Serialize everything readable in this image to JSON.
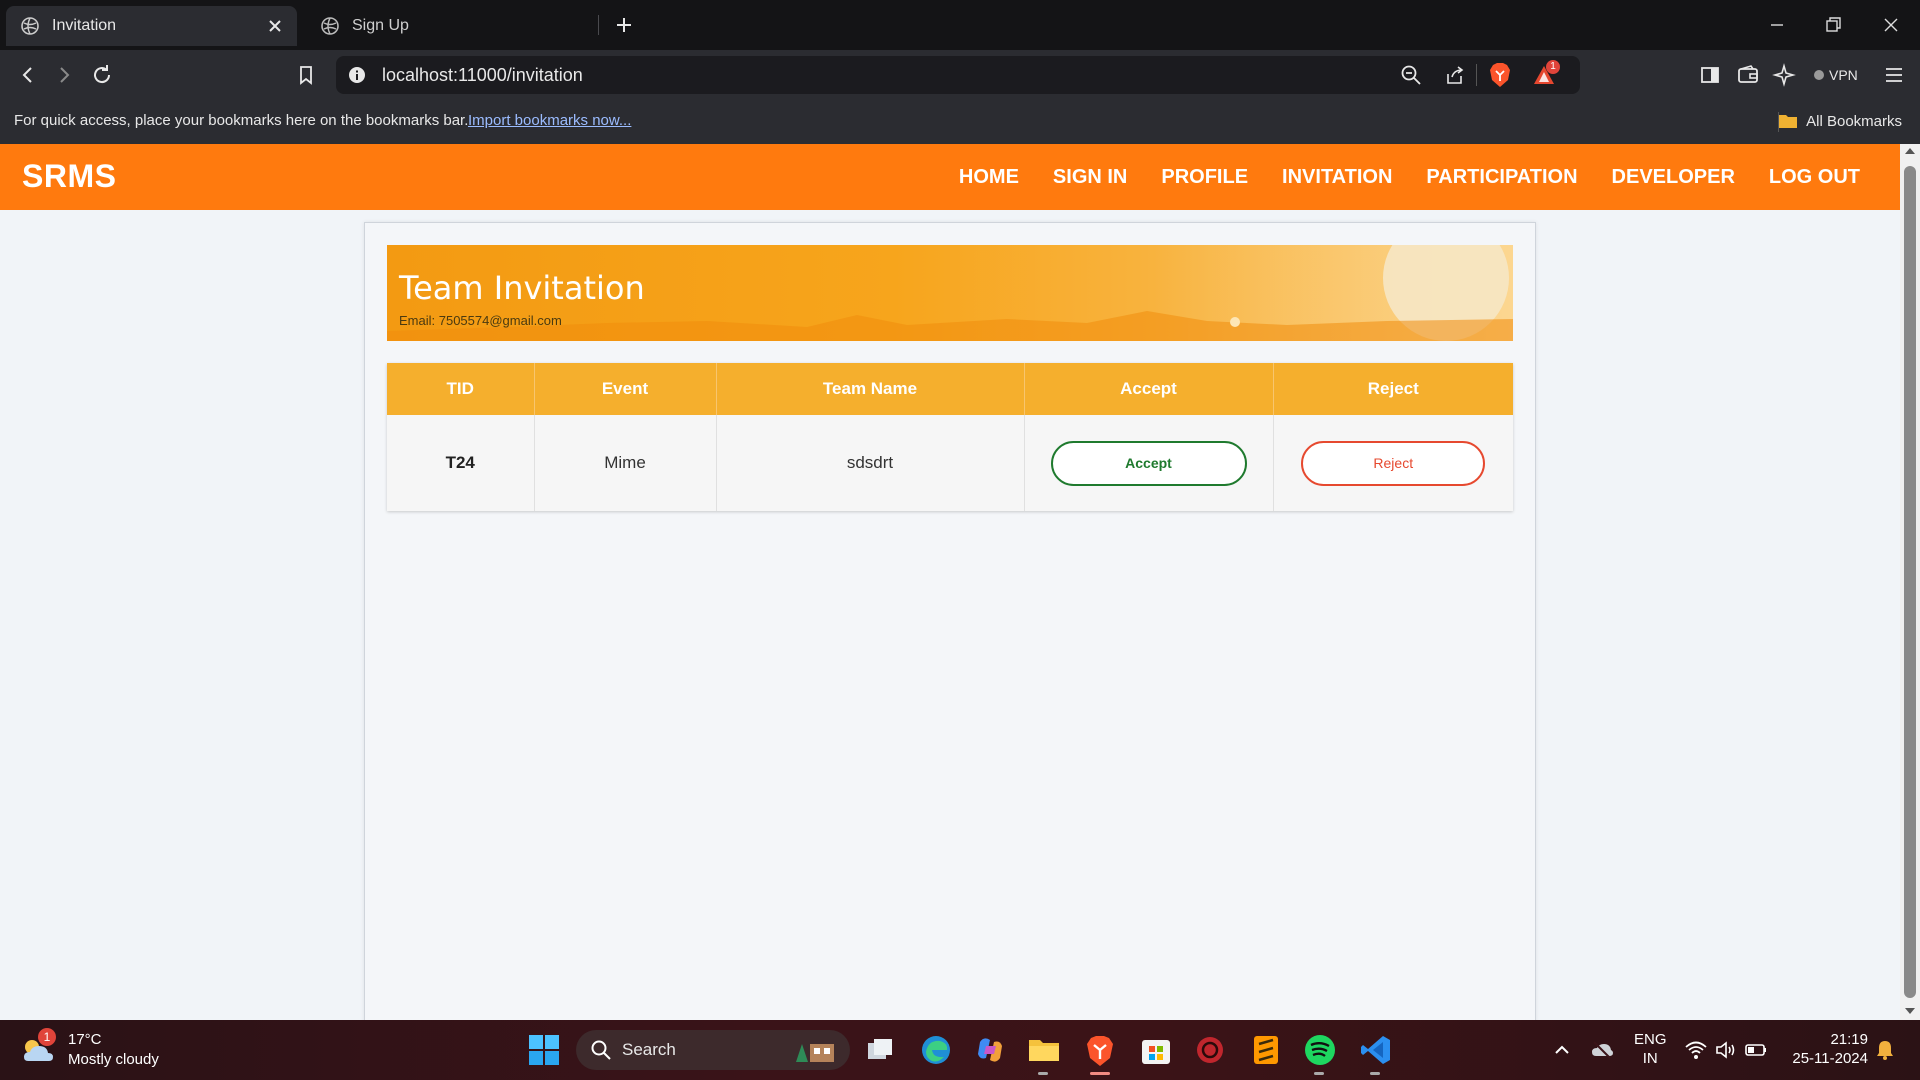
{
  "browser": {
    "tabs": [
      {
        "label": "Invitation",
        "active": true
      },
      {
        "label": "Sign Up",
        "active": false
      }
    ],
    "address": "localhost:11000/invitation",
    "vpn_label": "VPN",
    "notification_count": "1",
    "bookmarks_bar": {
      "hint": "For quick access, place your bookmarks here on the bookmarks bar.",
      "import_link": "Import bookmarks now...",
      "all_bookmarks": "All Bookmarks"
    }
  },
  "site": {
    "brand": "SRMS",
    "nav": [
      "HOME",
      "SIGN IN",
      "PROFILE",
      "INVITATION",
      "PARTICIPATION",
      "DEVELOPER",
      "LOG OUT"
    ],
    "accent_color": "#ff7a0e"
  },
  "banner": {
    "title": "Team Invitation",
    "email": "Email: 7505574@gmail.com"
  },
  "table": {
    "headers": [
      "TID",
      "Event",
      "Team Name",
      "Accept",
      "Reject"
    ],
    "rows": [
      {
        "tid": "T24",
        "event": "Mime",
        "team_name": "sdsdrt",
        "accept_label": "Accept",
        "reject_label": "Reject"
      }
    ]
  },
  "taskbar": {
    "weather": {
      "temp": "17°C",
      "condition": "Mostly cloudy",
      "badge": "1"
    },
    "search_label": "Search",
    "language": [
      "ENG",
      "IN"
    ],
    "time": "21:19",
    "date": "25-11-2024"
  }
}
